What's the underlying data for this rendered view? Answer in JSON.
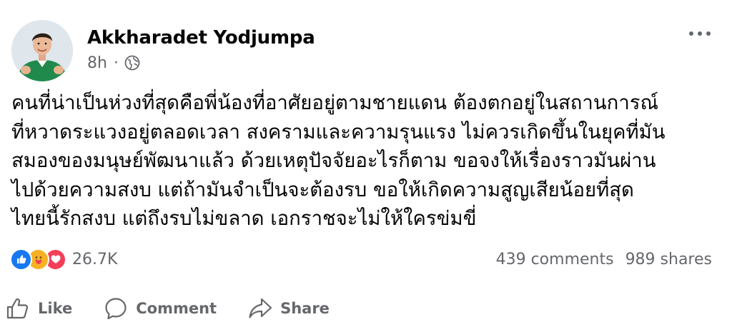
{
  "post": {
    "author": "Akkharadet Yodjumpa",
    "time": "8h",
    "separator": "·",
    "audience_icon": "globe-icon",
    "more_icon": "more-options-icon",
    "text_lines": [
      "คนที่น่าเป็นห่วงที่สุดคือพี่น้องที่อาศัยอยู่ตามชายแดน ต้องตกอยู่ในสถานการณ์",
      "ที่หวาดระแวงอยู่ตลอดเวลา สงครามและความรุนแรง ไม่ควรเกิดขึ้นในยุคที่มัน",
      "สมองของมนุษย์พัฒนาแล้ว  ด้วยเหตุปัจจัยอะไรก็ตาม ขอจงให้เรื่องราวมันผ่าน",
      "ไปด้วยความสงบ แต่ถ้ามันจำเป็นจะต้องรบ ขอให้เกิดความสูญเสียน้อยที่สุด",
      "ไทยนี้รักสงบ แต่ถึงรบไม่ขลาด เอกราชจะไม่ให้ใครข่มขี่"
    ]
  },
  "stats": {
    "reaction_icons": [
      "like-icon",
      "care-icon",
      "love-icon"
    ],
    "reaction_count": "26.7K",
    "comments": "439 comments",
    "shares": "989 shares"
  },
  "actions": {
    "like_label": "Like",
    "comment_label": "Comment",
    "share_label": "Share"
  },
  "colors": {
    "text": "#050505",
    "secondary": "#65676b",
    "like_blue": "#1877f2",
    "care_yellow": "#f7b125",
    "love_red": "#f33e58",
    "shirt_green": "#1f8a4c"
  }
}
